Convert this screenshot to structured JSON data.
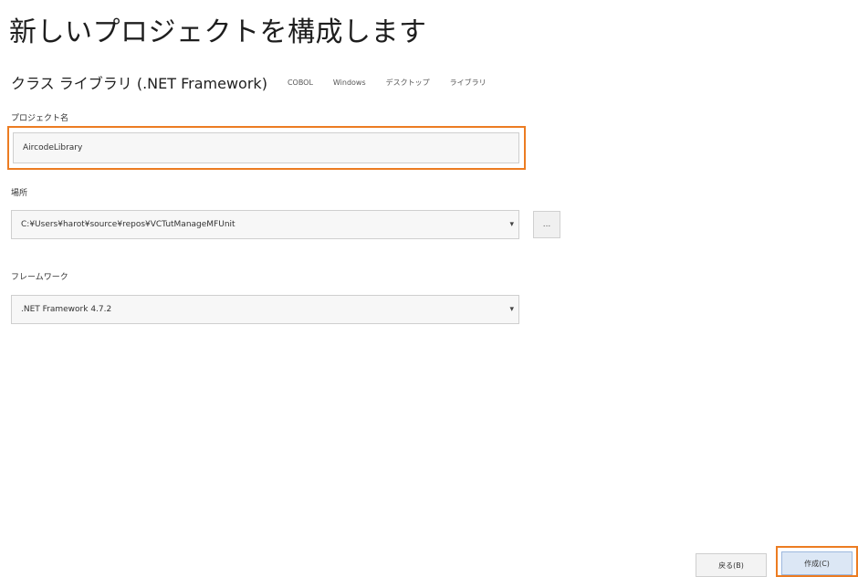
{
  "title": "新しいプロジェクトを構成します",
  "template": {
    "name": "クラス ライブラリ (.NET Framework)",
    "tags": [
      "COBOL",
      "Windows",
      "デスクトップ",
      "ライブラリ"
    ]
  },
  "project_name": {
    "label": "プロジェクト名",
    "value": "AircodeLibrary"
  },
  "location": {
    "label": "場所",
    "value": "C:¥Users¥harot¥source¥repos¥VCTutManageMFUnit",
    "browse": "..."
  },
  "framework": {
    "label": "フレームワーク",
    "value": ".NET Framework 4.7.2"
  },
  "footer": {
    "back_label": "戻る(B)",
    "create_label": "作成(C)"
  },
  "colors": {
    "highlight": "#ec7c22",
    "primary_button": "#dce7f5"
  }
}
